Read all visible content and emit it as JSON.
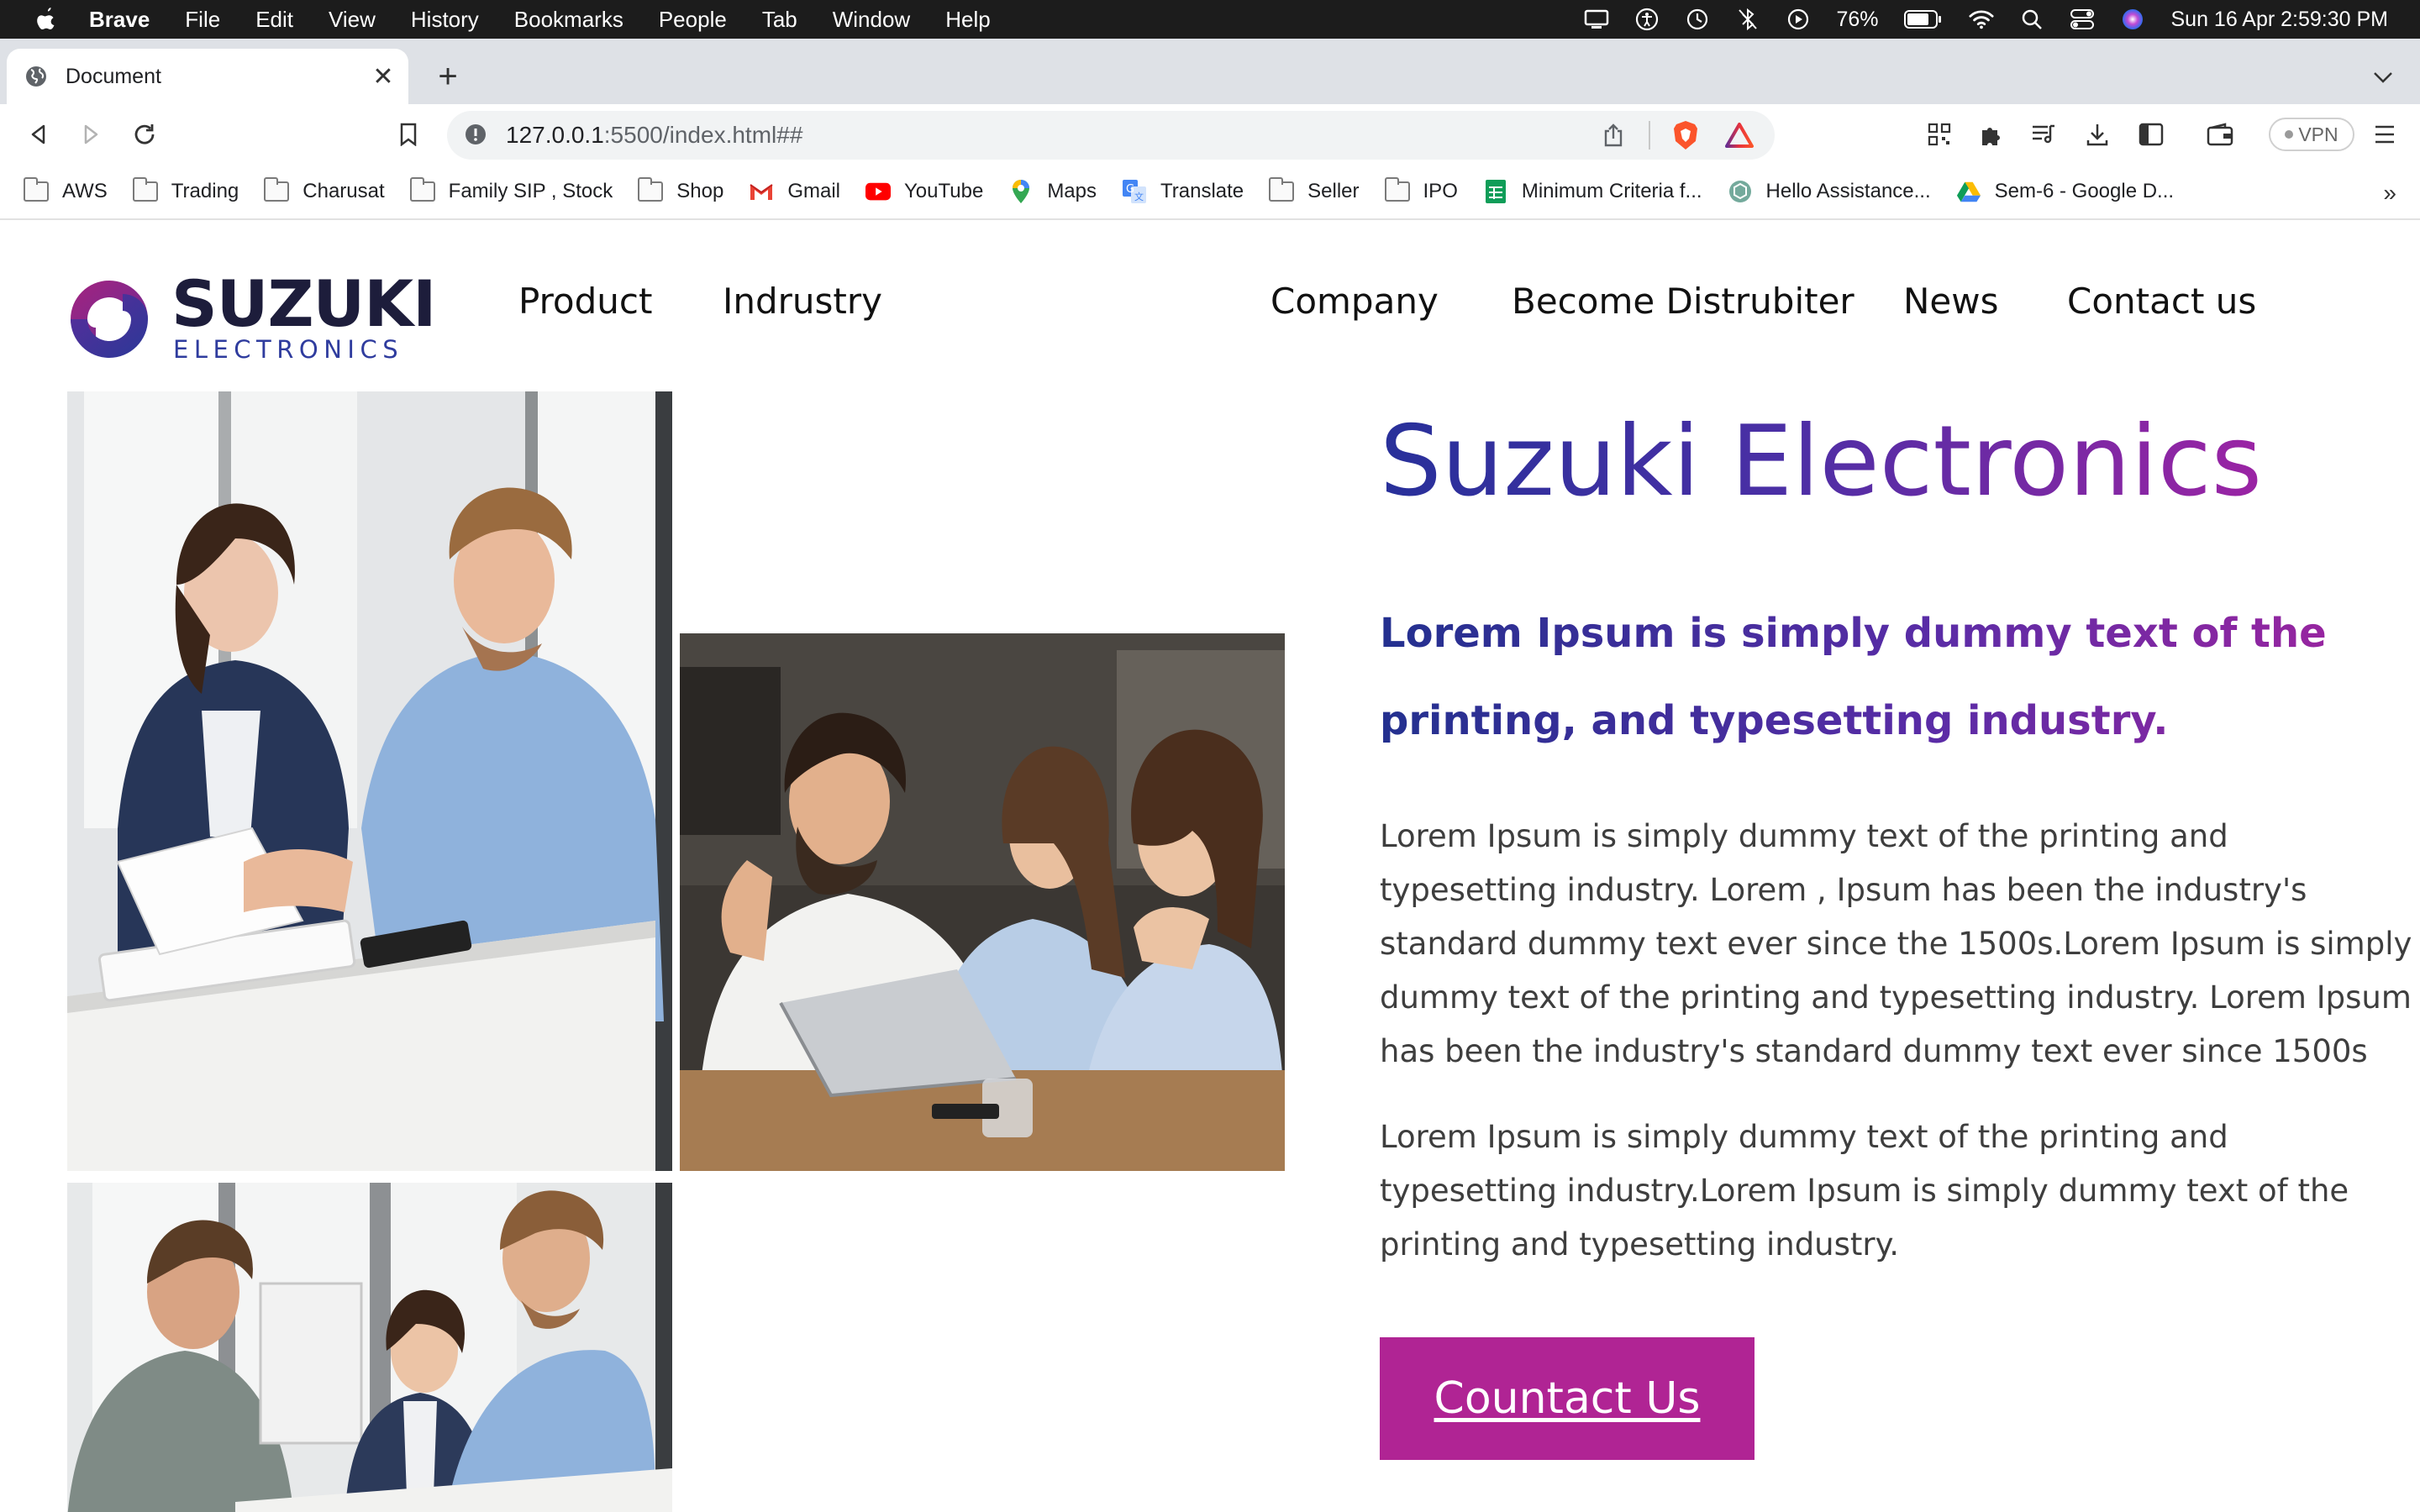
{
  "menubar": {
    "app": "Brave",
    "items": [
      "File",
      "Edit",
      "View",
      "History",
      "Bookmarks",
      "People",
      "Tab",
      "Window",
      "Help"
    ],
    "battery": "76%",
    "datetime": "Sun 16 Apr  2:59:30 PM"
  },
  "browser": {
    "tab_title": "Document",
    "url_host": "127.0.0.1",
    "url_path": ":5500/index.html##",
    "vpn_label": "VPN"
  },
  "bookmarks": [
    {
      "label": "AWS",
      "icon": "folder-icon"
    },
    {
      "label": "Trading",
      "icon": "folder-icon"
    },
    {
      "label": "Charusat",
      "icon": "folder-icon"
    },
    {
      "label": "Family SIP , Stock",
      "icon": "folder-icon"
    },
    {
      "label": "Shop",
      "icon": "folder-icon"
    },
    {
      "label": "Gmail",
      "icon": "gmail-icon"
    },
    {
      "label": "YouTube",
      "icon": "youtube-icon"
    },
    {
      "label": "Maps",
      "icon": "maps-icon"
    },
    {
      "label": "Translate",
      "icon": "translate-icon"
    },
    {
      "label": "Seller",
      "icon": "folder-icon"
    },
    {
      "label": "IPO",
      "icon": "folder-icon"
    },
    {
      "label": "Minimum Criteria f...",
      "icon": "sheets-icon"
    },
    {
      "label": "Hello Assistance...",
      "icon": "chatgpt-icon"
    },
    {
      "label": "Sem-6 - Google D...",
      "icon": "drive-icon"
    }
  ],
  "site": {
    "logo_word": "SUZUKI",
    "logo_sub": "ELECTRONICS",
    "nav": {
      "product": "Product",
      "industry": "Indrustry",
      "company": "Company",
      "distributor": "Become Distrubiter",
      "news": "News",
      "contact": "Contact us"
    },
    "hero": {
      "title": "Suzuki Electronics",
      "subtitle": "Lorem Ipsum is simply dummy text of the printing, and typesetting industry.",
      "para1": "Lorem Ipsum is simply dummy text of the printing and typesetting industry. Lorem , Ipsum has been the industry's standard dummy text ever since the 1500s.Lorem Ipsum is simply dummy text of the printing and typesetting industry. Lorem Ipsum has been the industry's standard dummy text ever since 1500s",
      "para2": "Lorem Ipsum is simply dummy text of the printing and typesetting industry.Lorem Ipsum is simply dummy text of the printing and typesetting industry.",
      "button": "Countact Us"
    }
  },
  "colors": {
    "brand_blue": "#28309a",
    "brand_purple": "#9b24a4",
    "button_bg": "#b02494"
  }
}
